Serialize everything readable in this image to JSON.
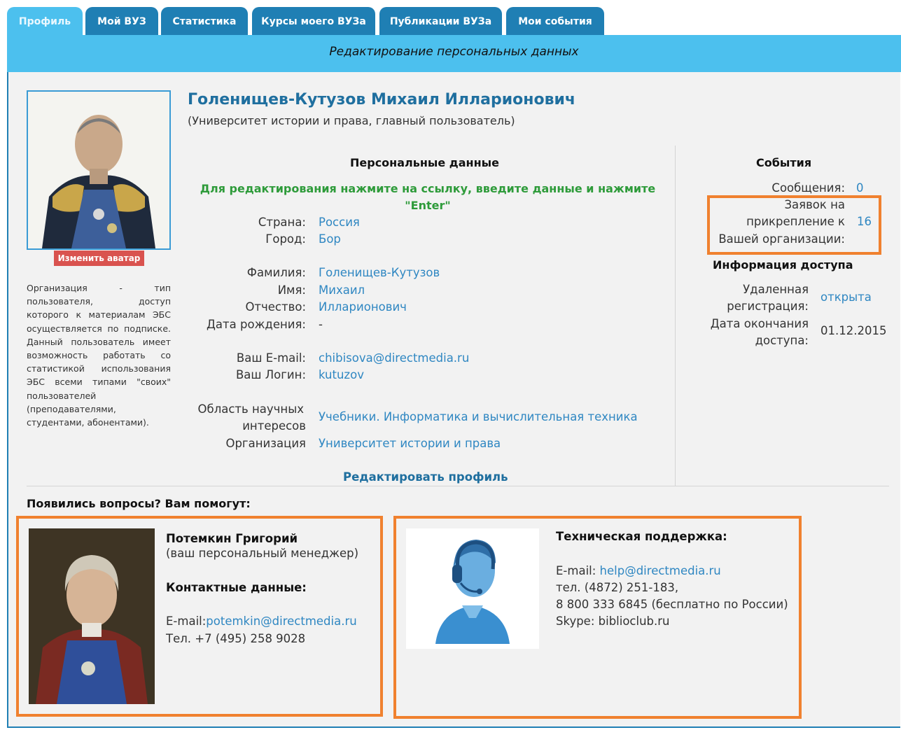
{
  "tabs": [
    "Профиль",
    "Мой ВУЗ",
    "Статистика",
    "Курсы моего ВУЗа",
    "Публикации ВУЗа",
    "Мои события"
  ],
  "subtitle": "Редактирование персональных данных",
  "avatar": {
    "button": "Изменить аватар"
  },
  "org_desc": "Организация - тип пользователя, доступ которого к материалам ЭБС осуществляется по подписке. Данный пользователь имеет возможность работать со статистикой использования ЭБС всеми типами \"своих\" пользователей (преподавателями, студентами, абонентами).",
  "user": {
    "full_name": "Голенищев-Кутузов Михаил Илларионович",
    "affiliation": "(Университет истории и права, главный пользователь)"
  },
  "personal": {
    "heading": "Персональные данные",
    "hint": "Для редактирования нажмите на ссылку, введите данные и нажмите \"Enter\"",
    "country_label": "Страна:",
    "country": "Россия",
    "city_label": "Город:",
    "city": "Бор",
    "surname_label": "Фамилия:",
    "surname": "Голенищев-Кутузов",
    "firstname_label": "Имя:",
    "firstname": "Михаил",
    "patronymic_label": "Отчество:",
    "patronymic": "Илларионович",
    "birthdate_label": "Дата рождения:",
    "birthdate": "-",
    "email_label": "Ваш E-mail:",
    "email": "chibisova@directmedia.ru",
    "login_label": "Ваш Логин:",
    "login": "kutuzov",
    "interests_label_1": "Область научных",
    "interests_label_2": "интересов",
    "interests": "Учебники. Информатика и вычислительная техника",
    "org_label": "Организация",
    "org": "Университет истории и права",
    "edit_link": "Редактировать профиль"
  },
  "events": {
    "heading": "События",
    "messages_label": "Сообщения:",
    "messages_count": "0",
    "requests_label_1": "Заявок на",
    "requests_label_2": "прикрепление к",
    "requests_label_3": "Вашей организации:",
    "requests_count": "16"
  },
  "access": {
    "heading": "Информация доступа",
    "remote_label_1": "Удаленная",
    "remote_label_2": "регистрация:",
    "remote_value": "открыта",
    "end_label_1": "Дата окончания",
    "end_label_2": "доступа:",
    "end_value": "01.12.2015"
  },
  "help": {
    "heading": "Появились вопросы? Вам помогут:",
    "manager": {
      "name": "Потемкин Григорий",
      "role": "(ваш персональный менеджер)",
      "contacts_heading": "Контактные данные:",
      "email_label": "E-mail:",
      "email": "potemkin@directmedia.ru",
      "phone": "Тел. +7 (495) 258 9028"
    },
    "support": {
      "heading": "Техническая поддержка:",
      "email_label": "E-mail:",
      "email": "help@directmedia.ru",
      "phone1": "тел. (4872) 251-183,",
      "phone2": "8 800 333 6845 (бесплатно по России)",
      "skype": "Skype: biblioclub.ru"
    }
  },
  "colors": {
    "tab": "#1f7fb4",
    "tab_active": "#4cc0ee",
    "highlight": "#f0812f",
    "link": "#2f87c2",
    "hint": "#2e9b3a"
  }
}
